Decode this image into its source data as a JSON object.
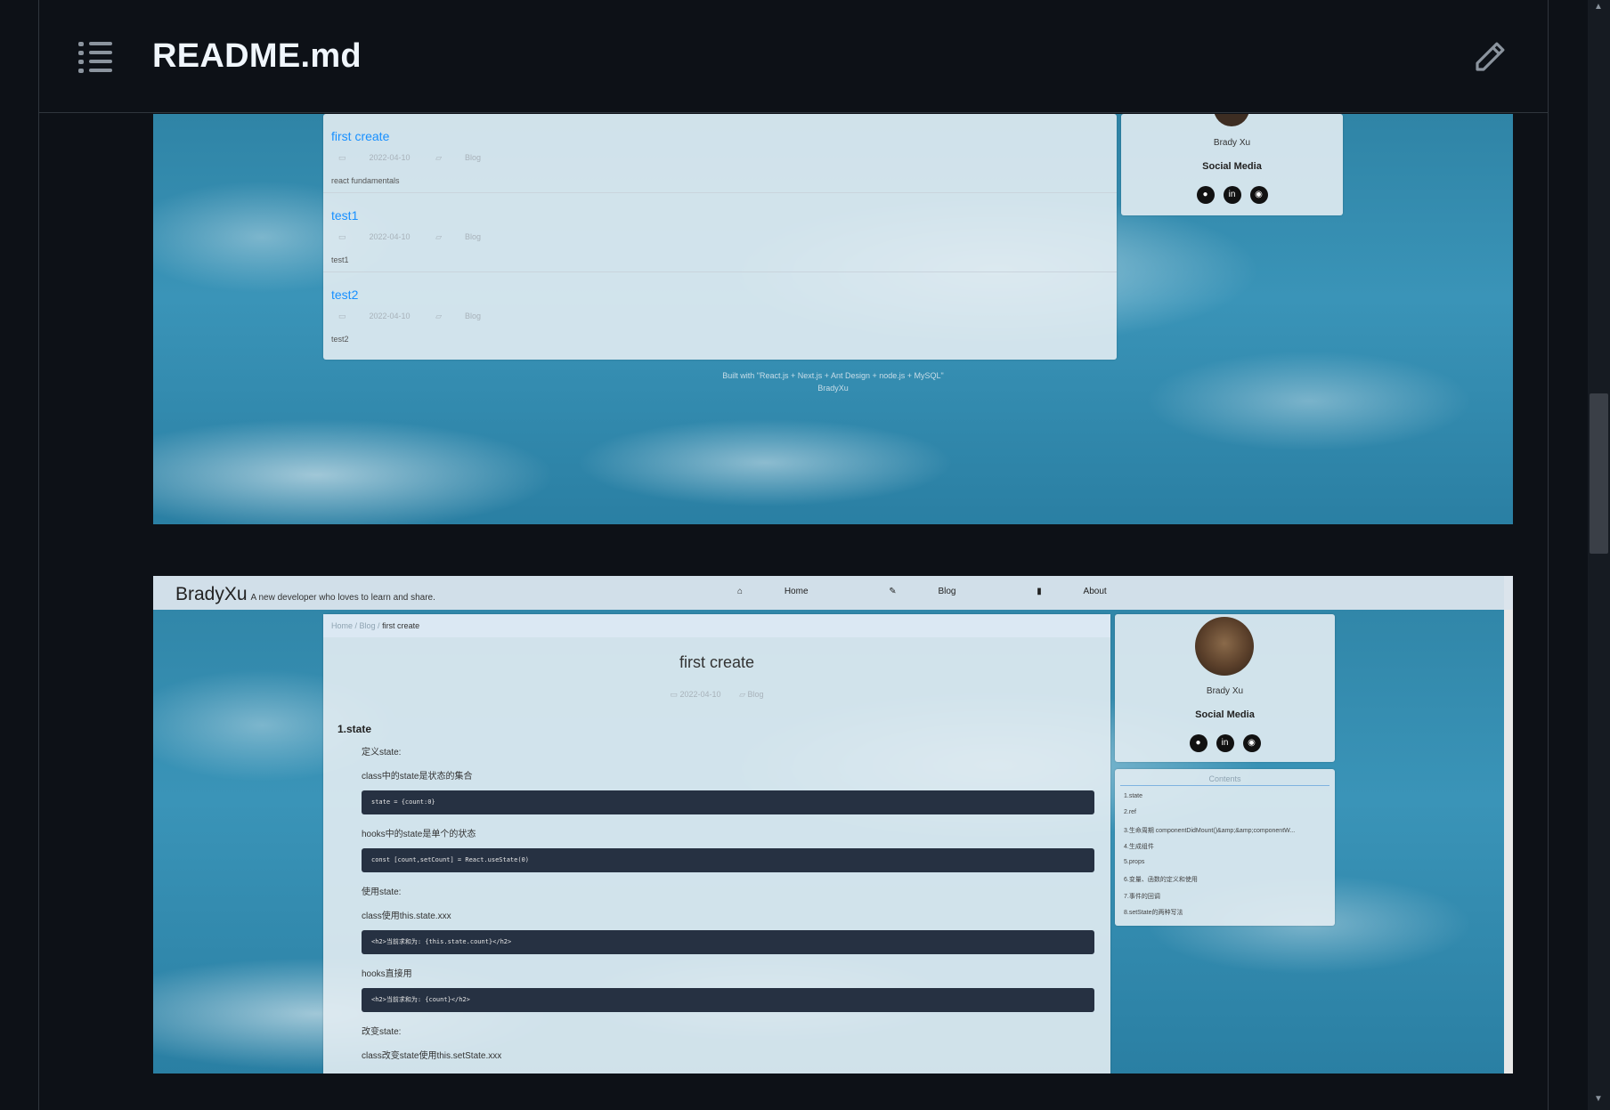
{
  "header": {
    "file_name": "README.md"
  },
  "shot1": {
    "posts": [
      {
        "title": "first create",
        "date": "2022-04-10",
        "category": "Blog",
        "desc": "react fundamentals"
      },
      {
        "title": "test1",
        "date": "2022-04-10",
        "category": "Blog",
        "desc": "test1"
      },
      {
        "title": "test2",
        "date": "2022-04-10",
        "category": "Blog",
        "desc": "test2"
      }
    ],
    "author": "Brady Xu",
    "social_title": "Social Media",
    "footer_line1": "Built with \"React.js + Next.js + Ant Design + node.js + MySQL\"",
    "footer_line2": "BradyXu"
  },
  "shot2": {
    "brand": "BradyXu",
    "tagline": "A new developer who loves to learn and share.",
    "nav": [
      "Home",
      "Blog",
      "About"
    ],
    "breadcrumb": {
      "home": "Home",
      "blog": "Blog",
      "current": "first create"
    },
    "title": "first create",
    "date": "2022-04-10",
    "category": "Blog",
    "section": "1.state",
    "lines": {
      "l1": "定义state:",
      "l2": "class中的state是状态的集合",
      "c1": "state = {count:0}",
      "l3": "hooks中的state是单个的状态",
      "c2": "const [count,setCount] = React.useState(0)",
      "l4": "使用state:",
      "l5": "class使用this.state.xxx",
      "c3": "<h2>当前求和为: {this.state.count}</h2>",
      "l6": "hooks直接用",
      "c4": "<h2>当前求和为: {count}</h2>",
      "l7": "改变state:",
      "l8": "class改变state使用this.setState.xxx"
    },
    "author": "Brady Xu",
    "social_title": "Social Media",
    "contents_title": "Contents",
    "contents": [
      "1.state",
      "2.ref",
      "3.生命周期 componentDidMount()&amp;&amp;componentW...",
      "4.生成组件",
      "5.props",
      "6.变量、函数的定义和使用",
      "7.事件的回调",
      "8.setState的两种写法"
    ]
  }
}
